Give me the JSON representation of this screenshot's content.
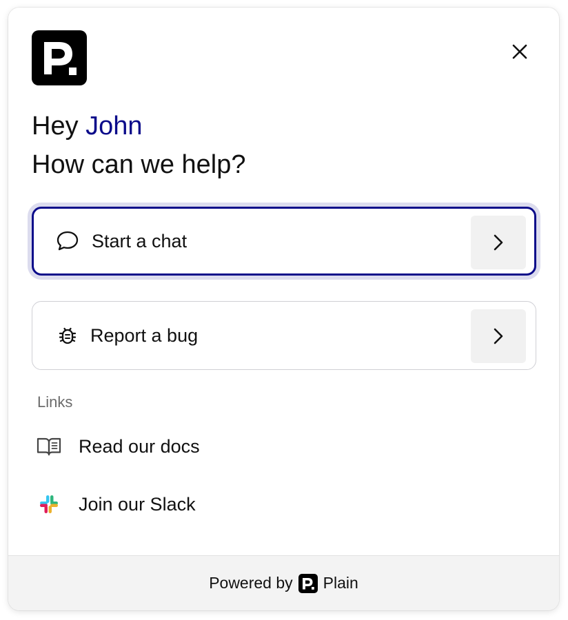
{
  "brand": {
    "logo_icon": "plain-logo-icon",
    "accent_color": "#0a0a8a"
  },
  "header": {
    "close_icon": "close-icon"
  },
  "greeting": {
    "prefix": "Hey",
    "name": "John",
    "question": "How can we help?"
  },
  "actions": [
    {
      "label": "Start a chat",
      "icon": "chat-bubble-icon",
      "selected": true
    },
    {
      "label": "Report a bug",
      "icon": "bug-icon",
      "selected": false
    }
  ],
  "links": {
    "heading": "Links",
    "items": [
      {
        "label": "Read our docs",
        "icon": "book-icon"
      },
      {
        "label": "Join our Slack",
        "icon": "slack-icon"
      }
    ]
  },
  "footer": {
    "powered_by": "Powered by",
    "brand_name": "Plain"
  }
}
